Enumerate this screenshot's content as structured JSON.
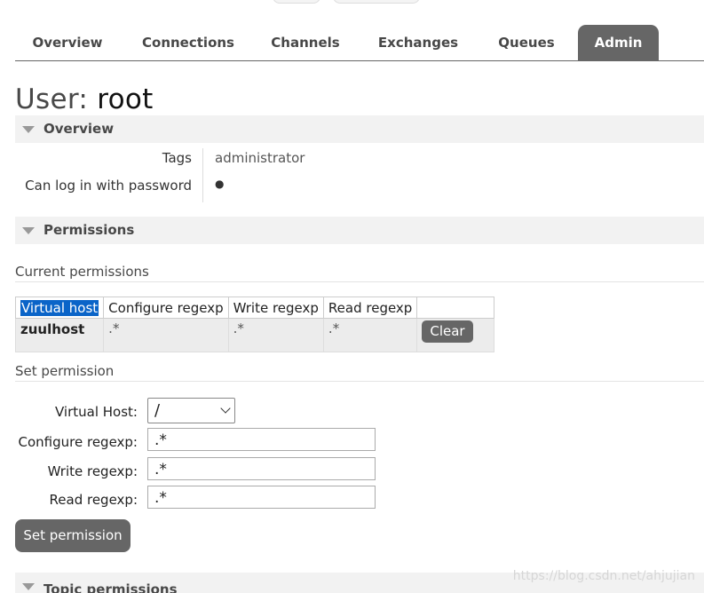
{
  "nav": {
    "tabs": [
      {
        "label": "Overview"
      },
      {
        "label": "Connections"
      },
      {
        "label": "Channels"
      },
      {
        "label": "Exchanges"
      },
      {
        "label": "Queues"
      },
      {
        "label": "Admin"
      }
    ],
    "active_tab": "Admin"
  },
  "title": {
    "prefix": "User:",
    "name": "root"
  },
  "overview": {
    "header": "Overview",
    "facts": [
      {
        "label": "Tags",
        "value": "administrator"
      },
      {
        "label": "Can log in with password",
        "value": "●"
      }
    ]
  },
  "permissions": {
    "header": "Permissions",
    "current_title": "Current permissions",
    "columns": [
      "Virtual host",
      "Configure regexp",
      "Write regexp",
      "Read regexp",
      ""
    ],
    "rows": [
      {
        "vhost": "zuulhost",
        "configure": ".*",
        "write": ".*",
        "read": ".*",
        "action": "Clear"
      }
    ],
    "set_title": "Set permission",
    "form": {
      "vhost_label": "Virtual Host:",
      "vhost_value": "/",
      "configure_label": "Configure regexp:",
      "configure_value": ".*",
      "write_label": "Write regexp:",
      "write_value": ".*",
      "read_label": "Read regexp:",
      "read_value": ".*",
      "submit": "Set permission"
    }
  },
  "topic_permissions": {
    "header": "Topic permissions"
  },
  "watermark": "https://blog.csdn.net/ahjujian",
  "colors": {
    "accent": "#666666",
    "section_bg": "#f2f2f2",
    "selection": "#0a64c8"
  }
}
